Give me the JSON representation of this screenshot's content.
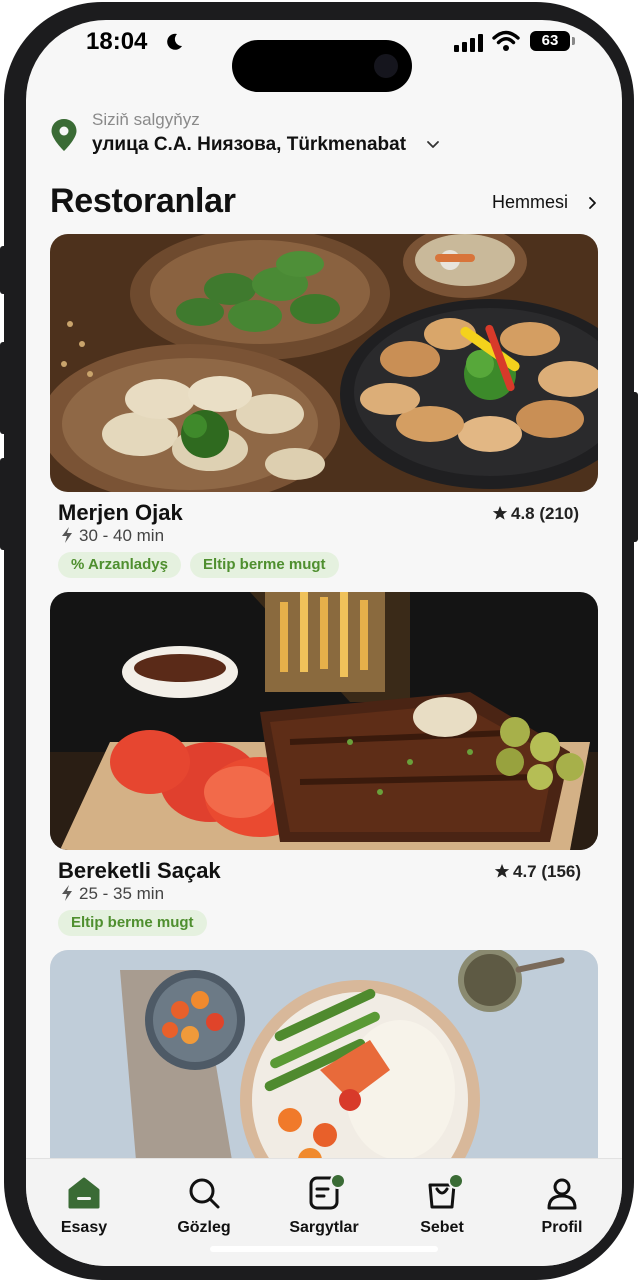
{
  "status_bar": {
    "time": "18:04",
    "battery": "63"
  },
  "location": {
    "label": "Siziň salgyňyz",
    "address": "улица С.А. Ниязова, Türkmenabat"
  },
  "section": {
    "title": "Restoranlar",
    "see_all": "Hemmesi"
  },
  "restaurants": [
    {
      "name": "Merjen Ojak",
      "rating": "4.8 (210)",
      "delivery_time": "30 - 40 min",
      "tags": [
        "% Arzanladyş",
        "Eltip berme mugt"
      ]
    },
    {
      "name": "Bereketli Saçak",
      "rating": "4.7 (156)",
      "delivery_time": "25 - 35 min",
      "tags": [
        "Eltip berme mugt"
      ]
    }
  ],
  "tabs": [
    {
      "label": "Esasy",
      "icon": "home-icon",
      "active": true
    },
    {
      "label": "Gözleg",
      "icon": "search-icon"
    },
    {
      "label": "Sargytlar",
      "icon": "orders-icon"
    },
    {
      "label": "Sebet",
      "icon": "bag-icon"
    },
    {
      "label": "Profil",
      "icon": "profile-icon"
    }
  ],
  "colors": {
    "accent": "#3a6b35",
    "tag_bg": "#e5f1df",
    "tag_text": "#4f8f2f"
  }
}
